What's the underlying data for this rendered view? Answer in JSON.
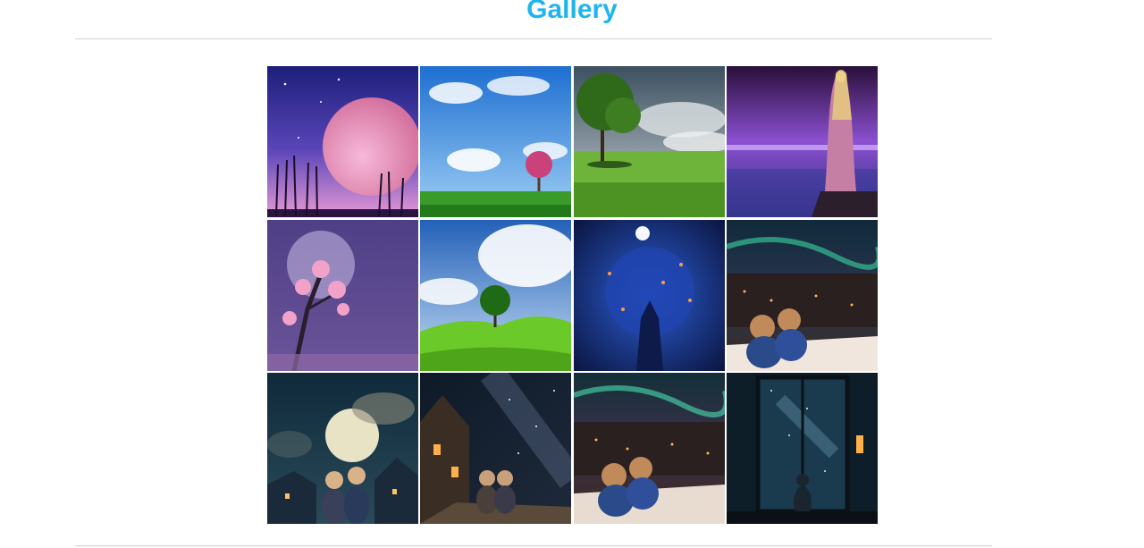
{
  "page": {
    "title": "Gallery"
  },
  "gallery": {
    "images": [
      {
        "name": "pink-moon-night-trees"
      },
      {
        "name": "blossom-tree-blue-sky-meadow"
      },
      {
        "name": "lone-tree-cloudy-field"
      },
      {
        "name": "woman-on-cliff-purple-sea"
      },
      {
        "name": "cherry-blossom-purple-moon"
      },
      {
        "name": "green-tree-on-hill"
      },
      {
        "name": "glowing-blue-tree-full-moon"
      },
      {
        "name": "children-rooftop-aurora-town"
      },
      {
        "name": "children-watching-giant-moon"
      },
      {
        "name": "children-house-milky-way"
      },
      {
        "name": "children-rooftop-aurora-town-2"
      },
      {
        "name": "child-at-window-starry-night"
      }
    ]
  }
}
